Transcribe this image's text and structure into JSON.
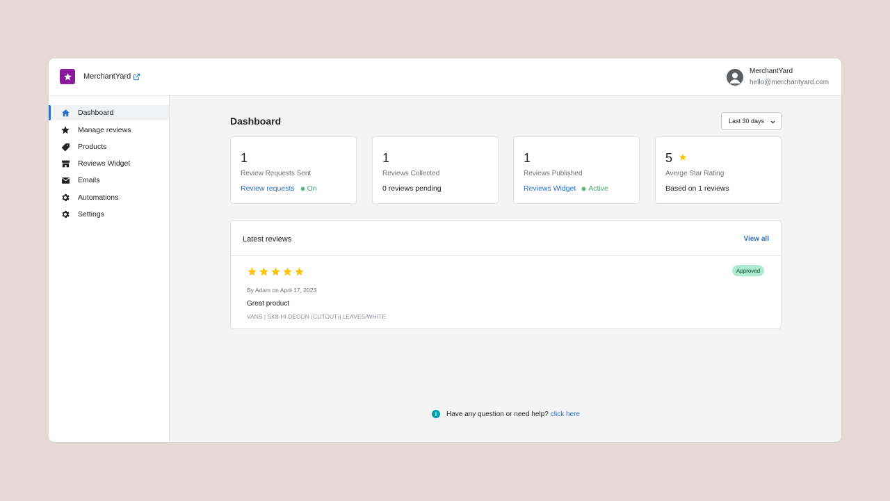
{
  "header": {
    "brand": "MerchantYard",
    "user_name": "MerchantYard",
    "user_email": "hello@merchantyard.com",
    "logo_color": "#8a1a9c"
  },
  "sidebar": {
    "items": [
      {
        "label": "Dashboard",
        "icon": "home-icon",
        "active": true
      },
      {
        "label": "Manage reviews",
        "icon": "star-icon"
      },
      {
        "label": "Products",
        "icon": "tag-icon"
      },
      {
        "label": "Reviews Widget",
        "icon": "storefront-icon"
      },
      {
        "label": "Emails",
        "icon": "envelope-icon"
      },
      {
        "label": "Automations",
        "icon": "gear-icon"
      },
      {
        "label": "Settings",
        "icon": "gear-icon"
      }
    ]
  },
  "main": {
    "title": "Dashboard",
    "date_range": "Last 30 days",
    "stats": [
      {
        "value": "1",
        "label": "Review Requests Sent",
        "link": "Review requests",
        "status": "On"
      },
      {
        "value": "1",
        "label": "Reviews Collected",
        "foot": "0 reviews pending"
      },
      {
        "value": "1",
        "label": "Reviews Published",
        "link": "Reviews Widget",
        "status": "Active"
      },
      {
        "value": "5",
        "label": "Averge Star Rating",
        "foot": "Based on 1 reviews"
      }
    ],
    "latest_reviews": {
      "title": "Latest reviews",
      "view_all": "View all",
      "review": {
        "rating": 5,
        "badge": "Approved",
        "meta": "By Adam on April 17, 2023",
        "body": "Great product",
        "product": "VANS | SK8-HI DECON (CUTOUT)| LEAVES/WHITE"
      }
    },
    "help": {
      "text": "Have any question or need help?",
      "link": "click here"
    }
  },
  "colors": {
    "accent": "#2c6ecb",
    "star": "#ffc107",
    "status_green": "#48a56e",
    "badge_bg": "#aee9d1",
    "page_bg": "#e5d9d7"
  }
}
